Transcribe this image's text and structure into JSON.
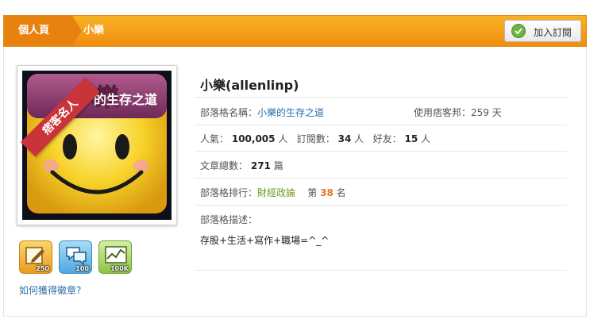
{
  "breadcrumb": {
    "home": "個人頁",
    "current": "小樂"
  },
  "subscribe": {
    "label": "加入訂閱"
  },
  "avatar": {
    "ribbon": "痞客名人",
    "logo_main": "小樂",
    "logo_sub": "的生存之道"
  },
  "badges": [
    {
      "name": "article",
      "count": "250"
    },
    {
      "name": "comment",
      "count": "100"
    },
    {
      "name": "popularity",
      "count": "100K"
    }
  ],
  "how_to_badge": "如何獲得徽章?",
  "profile": {
    "name": "小樂(allenlinp)",
    "blog_name_label": "部落格名稱：",
    "blog_name": "小樂的生存之道",
    "usage_label": "使用痞客邦：",
    "usage_days": "259",
    "usage_unit": "天",
    "pop_label": "人氣：",
    "pop_value": "100,005",
    "pop_unit": "人",
    "sub_label": "訂閱數：",
    "sub_value": "34",
    "sub_unit": "人",
    "friend_label": "好友：",
    "friend_value": "15",
    "friend_unit": "人",
    "articles_label": "文章總數：",
    "articles_value": "271",
    "articles_unit": "篇",
    "rank_label": "部落格排行：",
    "rank_category": "財經政論",
    "rank_prefix": "第",
    "rank_value": "38",
    "rank_suffix": "名",
    "desc_label": "部落格描述：",
    "desc": "存股+生活+寫作+職場=^_^"
  },
  "colors": {
    "accent": "#f08c10",
    "link": "#2a6ea9",
    "category": "#6e9a1f",
    "rank": "#e87524"
  }
}
